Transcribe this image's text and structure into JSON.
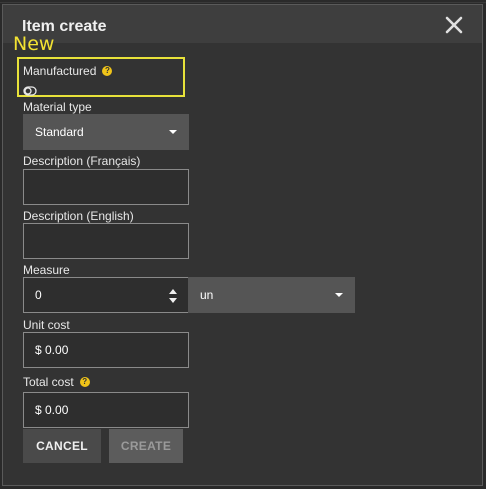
{
  "dialog": {
    "title": "Item create",
    "close_icon": "close-icon"
  },
  "annotation": {
    "new_label": "New",
    "highlight_color": "#f2e233"
  },
  "fields": {
    "manufactured": {
      "label": "Manufactured",
      "help_icon": "question-icon",
      "toggle_icon": "toggle-icon",
      "toggled": false
    },
    "material_type": {
      "label": "Material type",
      "value": "Standard"
    },
    "description_fr": {
      "label": "Description (Français)",
      "value": ""
    },
    "description_en": {
      "label": "Description (English)",
      "value": ""
    },
    "measure": {
      "label": "Measure",
      "value": "0",
      "unit": "un"
    },
    "unit_cost": {
      "label": "Unit cost",
      "value": "$ 0.00"
    },
    "total_cost": {
      "label": "Total cost",
      "value": "$ 0.00",
      "help_icon": "question-icon"
    }
  },
  "actions": {
    "cancel": "CANCEL",
    "create": "CREATE"
  },
  "colors": {
    "help_icon": "#f0c419",
    "dialog_bg": "#333333",
    "select_bg": "#555555"
  }
}
